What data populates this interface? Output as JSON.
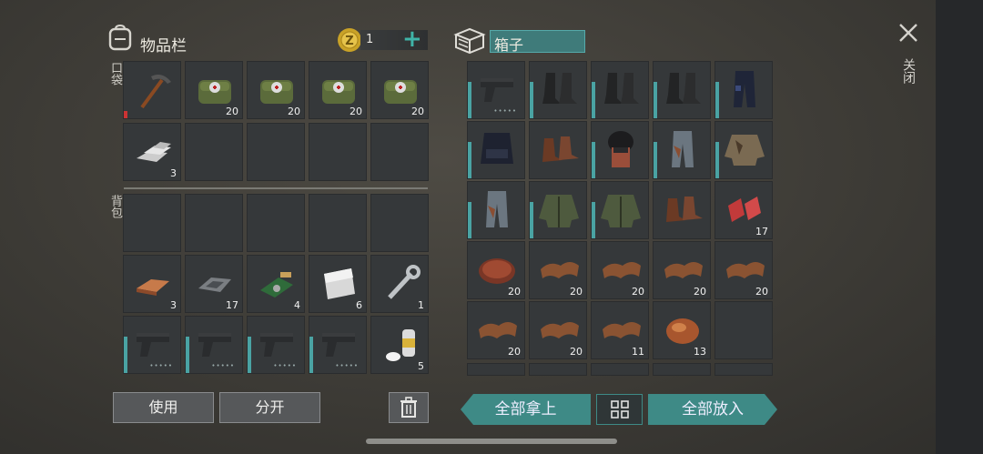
{
  "inventory": {
    "title": "物品栏",
    "coins": "1",
    "add_label": "+",
    "pocket_label": "口袋",
    "backpack_label": "背包",
    "pocket_slots": [
      {
        "item": "pickaxe-icon",
        "qty": "",
        "dura": "red"
      },
      {
        "item": "medkit-bag-icon",
        "qty": "20",
        "dura": ""
      },
      {
        "item": "medkit-bag-icon",
        "qty": "20",
        "dura": ""
      },
      {
        "item": "medkit-bag-icon",
        "qty": "20",
        "dura": ""
      },
      {
        "item": "medkit-bag-icon",
        "qty": "20",
        "dura": ""
      },
      {
        "item": "aluminum-ingot-icon",
        "qty": "3",
        "dura": ""
      },
      {
        "item": "",
        "qty": "",
        "dura": ""
      },
      {
        "item": "",
        "qty": "",
        "dura": ""
      },
      {
        "item": "",
        "qty": "",
        "dura": ""
      },
      {
        "item": "",
        "qty": "",
        "dura": ""
      }
    ],
    "backpack_slots": [
      {
        "item": "",
        "qty": "",
        "dura": ""
      },
      {
        "item": "",
        "qty": "",
        "dura": ""
      },
      {
        "item": "",
        "qty": "",
        "dura": ""
      },
      {
        "item": "",
        "qty": "",
        "dura": ""
      },
      {
        "item": "",
        "qty": "",
        "dura": ""
      },
      {
        "item": "copper-ingot-icon",
        "qty": "3",
        "dura": ""
      },
      {
        "item": "iron-ingot-icon",
        "qty": "17",
        "dura": ""
      },
      {
        "item": "circuit-board-icon",
        "qty": "4",
        "dura": ""
      },
      {
        "item": "steel-plate-icon",
        "qty": "6",
        "dura": ""
      },
      {
        "item": "wrench-icon",
        "qty": "1",
        "dura": ""
      },
      {
        "item": "pistol-icon",
        "qty": "",
        "dura": "teal"
      },
      {
        "item": "pistol-icon",
        "qty": "",
        "dura": "teal"
      },
      {
        "item": "pistol-icon",
        "qty": "",
        "dura": "teal"
      },
      {
        "item": "pistol-icon",
        "qty": "",
        "dura": "teal"
      },
      {
        "item": "spray-can-icon",
        "qty": "5",
        "dura": ""
      }
    ],
    "use_label": "使用",
    "split_label": "分开"
  },
  "box": {
    "title": "箱子",
    "slots": [
      {
        "item": "pistol-icon",
        "qty": "",
        "dura": "teal"
      },
      {
        "item": "boots-icon",
        "qty": "",
        "dura": "teal"
      },
      {
        "item": "boots-icon",
        "qty": "",
        "dura": "teal"
      },
      {
        "item": "boots-icon",
        "qty": "",
        "dura": "teal"
      },
      {
        "item": "police-pants-icon",
        "qty": "",
        "dura": "teal"
      },
      {
        "item": "police-vest-icon",
        "qty": "",
        "dura": "teal"
      },
      {
        "item": "leather-boots-icon",
        "qty": "",
        "dura": ""
      },
      {
        "item": "helmet-icon",
        "qty": "",
        "dura": "teal"
      },
      {
        "item": "camo-pants-icon",
        "qty": "",
        "dura": "teal"
      },
      {
        "item": "camo-jacket-icon",
        "qty": "",
        "dura": "teal"
      },
      {
        "item": "camo-pants-icon",
        "qty": "",
        "dura": "teal"
      },
      {
        "item": "green-jacket-icon",
        "qty": "",
        "dura": "teal"
      },
      {
        "item": "green-jacket-icon",
        "qty": "",
        "dura": "teal"
      },
      {
        "item": "leather-boots-icon",
        "qty": "",
        "dura": ""
      },
      {
        "item": "raw-meat-icon",
        "qty": "17",
        "dura": ""
      },
      {
        "item": "steak-icon",
        "qty": "20",
        "dura": ""
      },
      {
        "item": "leather-icon",
        "qty": "20",
        "dura": ""
      },
      {
        "item": "leather-icon",
        "qty": "20",
        "dura": ""
      },
      {
        "item": "leather-icon",
        "qty": "20",
        "dura": ""
      },
      {
        "item": "leather-icon",
        "qty": "20",
        "dura": ""
      },
      {
        "item": "leather-icon",
        "qty": "20",
        "dura": ""
      },
      {
        "item": "leather-icon",
        "qty": "20",
        "dura": ""
      },
      {
        "item": "leather-icon",
        "qty": "11",
        "dura": ""
      },
      {
        "item": "fried-meat-icon",
        "qty": "13",
        "dura": ""
      },
      {
        "item": "",
        "qty": "",
        "dura": ""
      }
    ],
    "take_all_label": "全部拿上",
    "put_all_label": "全部放入"
  },
  "close_label": "关闭",
  "colors": {
    "accent": "#3e8a86",
    "slot": "#35383a",
    "durability": "#4aa3a3"
  }
}
